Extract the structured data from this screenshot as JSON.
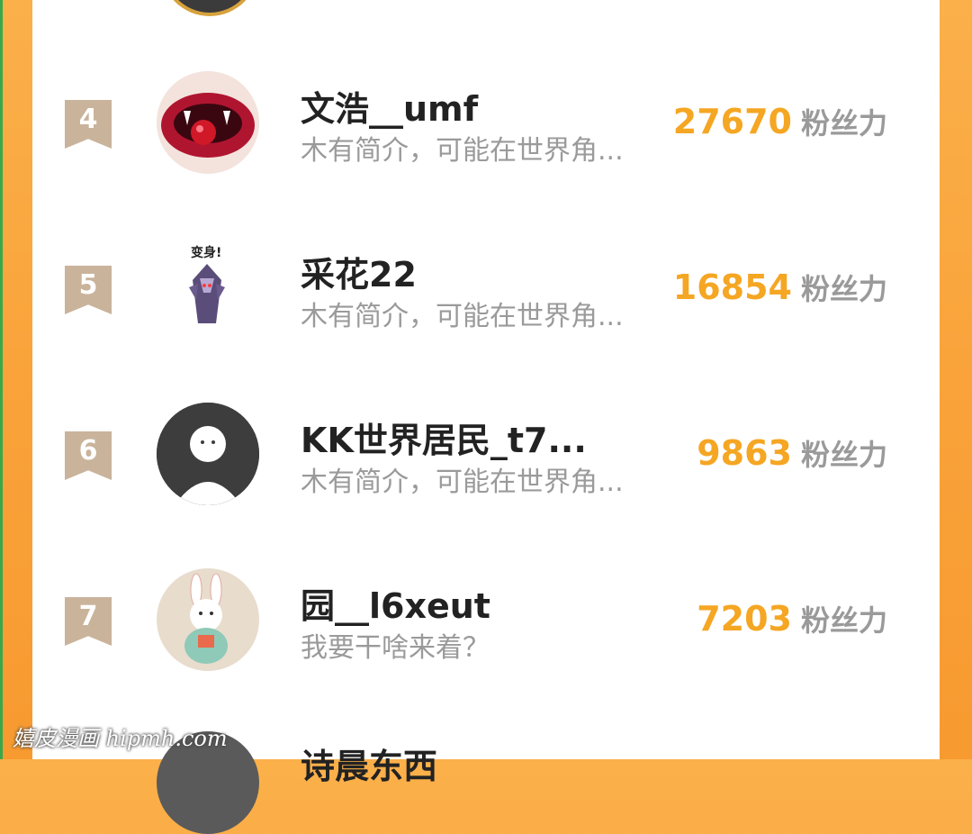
{
  "rows": [
    {
      "rank": "4",
      "username": "文浩__umf",
      "bio": "木有简介，可能在世界角...",
      "fans_count": "27670",
      "fans_unit": "粉丝力"
    },
    {
      "rank": "5",
      "username": "采花22",
      "bio": "木有简介，可能在世界角...",
      "fans_count": "16854",
      "fans_unit": "粉丝力"
    },
    {
      "rank": "6",
      "username": "KK世界居民_t7...",
      "bio": "木有简介，可能在世界角...",
      "fans_count": "9863",
      "fans_unit": "粉丝力"
    },
    {
      "rank": "7",
      "username": "园__l6xeut",
      "bio": "我要干啥来着？",
      "fans_count": "7203",
      "fans_unit": "粉丝力"
    }
  ],
  "partial_next_username": "诗晨东西",
  "watermark": "嬉皮漫画 hipmh.com",
  "colors": {
    "accent": "#f5a623",
    "badge": "#c9b39b",
    "frame": "#f9a33a"
  }
}
